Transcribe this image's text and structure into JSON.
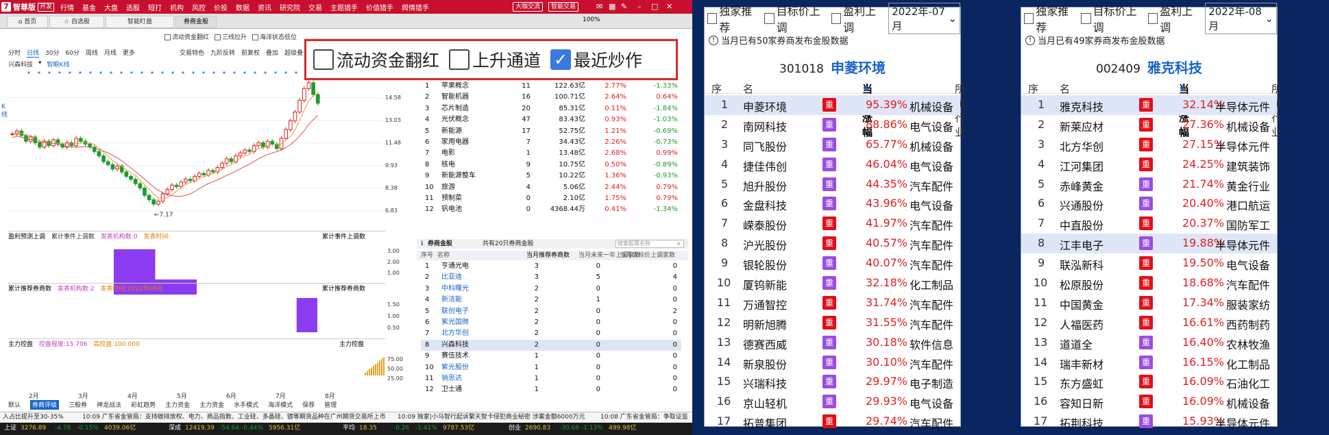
{
  "titlebar": {
    "logo_glyph": "7",
    "app_name": "智尊版",
    "version_badge": "开发",
    "menu": [
      "行情",
      "基金",
      "大盘",
      "选股",
      "短打",
      "机构",
      "风控",
      "价投",
      "数据",
      "资讯",
      "研究院",
      "交易",
      "主题猎手",
      "价值猎手",
      "舆情猎手"
    ],
    "pill_forum": "大咖交流",
    "pill_trade": "智能交易",
    "colors": {
      "bar": "#c8102e"
    }
  },
  "tabs": [
    "首页",
    "自选股",
    "智能盯盘",
    "券商金股"
  ],
  "checkbox_row": [
    "流动资金翻红",
    "三线拉升",
    "海洋状态低位"
  ],
  "zoom": "100%",
  "callout": {
    "items": [
      {
        "label": "流动资金翻红",
        "checked": false
      },
      {
        "label": "上升通道",
        "checked": false
      },
      {
        "label": "最近炒作",
        "checked": true
      }
    ]
  },
  "periods": [
    "分时",
    "日线",
    "30分",
    "60分",
    "周线",
    "月线",
    "更多"
  ],
  "period_active": "日线",
  "chart_tools": [
    "交易特色",
    "九阶反转",
    "前复权",
    "叠加",
    "超级叠"
  ],
  "stock_label": "兴森科技",
  "stock_sub": "智眼K线",
  "side_label": "K线",
  "chart_data": {
    "type": "line",
    "title": "",
    "x_ticks": [
      "2月",
      "3月",
      "4月",
      "5月",
      "6月",
      "7月",
      "8月"
    ],
    "y_ticks": [
      14.58,
      13.03,
      11.48,
      9.93,
      8.38,
      6.83
    ],
    "ylim": [
      6.83,
      16.2
    ],
    "low_label": "7.17",
    "close": [
      12.1,
      12.3,
      12.0,
      11.6,
      11.9,
      11.5,
      11.2,
      11.6,
      11.3,
      11.7,
      11.4,
      11.2,
      11.5,
      11.3,
      11.8,
      11.6,
      11.4,
      11.2,
      10.9,
      10.6,
      10.2,
      10.0,
      9.7,
      9.9,
      9.5,
      9.2,
      9.0,
      8.7,
      8.4,
      7.9,
      7.6,
      7.3,
      7.5,
      8.0,
      8.3,
      8.6,
      8.5,
      8.8,
      9.0,
      8.9,
      9.2,
      9.4,
      9.3,
      9.6,
      9.5,
      9.8,
      10.1,
      10.4,
      10.2,
      10.6,
      10.8,
      11.0,
      10.9,
      11.3,
      11.5,
      11.2,
      11.6,
      11.4,
      11.1,
      11.8,
      12.4,
      13.0,
      13.6,
      14.4,
      15.2,
      15.6,
      14.8,
      14.2
    ],
    "indicators": [
      {
        "name": "盈利预测上调",
        "tags": [
          "累计事件上调数"
        ],
        "count_label": "发表机构数:0",
        "time_label": "发表时间:",
        "right_label": "累计事件上调数",
        "y_ticks": [
          "3.00",
          "2.00",
          "1.00"
        ],
        "bars": [
          {
            "from": 0.28,
            "to": 0.39,
            "value": 3
          },
          {
            "from": 0.39,
            "to": 0.5,
            "value": 1
          }
        ]
      },
      {
        "name": "累计推荐券商数",
        "tags": [],
        "count_label": "发表机构数:2",
        "time_label": "发表时间:2022年08月",
        "right_label": "累计推荐券商数",
        "y_ticks": [
          "1.50",
          "1.00",
          "0.50"
        ],
        "bars": [
          {
            "from": 0.765,
            "to": 0.82,
            "value": 2
          }
        ]
      },
      {
        "name": "主力控盘",
        "tags": [],
        "count_label": "控盘程度:15.706",
        "time_label": "高控盘:100.000",
        "right_label": "主力控盘",
        "y_ticks": [
          "75.00",
          "50.00",
          "25.00"
        ],
        "bars": []
      }
    ]
  },
  "sector_table": {
    "rows": [
      [
        "1",
        "苹果概念",
        "11",
        "122.63亿",
        "2.77%",
        "-1.33%"
      ],
      [
        "2",
        "智能机器",
        "16",
        "100.71亿",
        "2.64%",
        "0.64%"
      ],
      [
        "3",
        "芯片制造",
        "20",
        "85.31亿",
        "0.11%",
        "-1.84%"
      ],
      [
        "4",
        "光伏概念",
        "47",
        "83.43亿",
        "0.93%",
        "-1.03%"
      ],
      [
        "5",
        "新能源",
        "17",
        "52.75亿",
        "1.21%",
        "-0.69%"
      ],
      [
        "6",
        "家用电器",
        "7",
        "34.43亿",
        "2.26%",
        "-0.73%"
      ],
      [
        "7",
        "电影",
        "1",
        "13.48亿",
        "2.68%",
        "0.99%"
      ],
      [
        "8",
        "核电",
        "9",
        "10.75亿",
        "0.50%",
        "-0.89%"
      ],
      [
        "9",
        "新能源整车",
        "5",
        "10.22亿",
        "1.36%",
        "-0.93%"
      ],
      [
        "10",
        "旅游",
        "4",
        "5.06亿",
        "2.44%",
        "0.79%"
      ],
      [
        "11",
        "预制菜",
        "0",
        "2.10亿",
        "1.75%",
        "0.79%"
      ],
      [
        "12",
        "钒电池",
        "0",
        "4368.44万",
        "0.41%",
        "-1.34%"
      ]
    ]
  },
  "broker_panel": {
    "title": "券商金股",
    "subtitle": "共有20只券商金股",
    "search_placeholder": "搜索股票名称",
    "headers": [
      "序号",
      "名称",
      "当月推荐券商数",
      "当月未来一年上调家数",
      "当月目标价上调家数"
    ],
    "rows": [
      [
        "1",
        "亨通光电",
        "3",
        "0",
        "0"
      ],
      [
        "2",
        "比亚迪",
        "3",
        "5",
        "4"
      ],
      [
        "3",
        "中科曙光",
        "2",
        "0",
        "0"
      ],
      [
        "4",
        "新洁能",
        "2",
        "1",
        "0"
      ],
      [
        "5",
        "联创电子",
        "2",
        "0",
        "2"
      ],
      [
        "6",
        "紫光国微",
        "2",
        "0",
        "0"
      ],
      [
        "7",
        "北方华创",
        "2",
        "0",
        "0"
      ],
      [
        "8",
        "兴森科技",
        "2",
        "0",
        "0"
      ],
      [
        "9",
        "赛伍技术",
        "1",
        "0",
        "0"
      ],
      [
        "10",
        "紫光股份",
        "1",
        "0",
        "0"
      ],
      [
        "11",
        "钠思达",
        "1",
        "0",
        "0"
      ],
      [
        "12",
        "卫士通",
        "1",
        "0",
        "0"
      ]
    ]
  },
  "bottom_tabs": [
    "默认",
    "券商评级",
    "三般券",
    "神龙战法",
    "彩虹趋势",
    "主力资金",
    "主力资金",
    "水手模式",
    "海洋模式",
    "保荐",
    "管理"
  ],
  "bottom_tab_active": "券商评级",
  "ticker": [
    "入占比提升至30-35%",
    "10:09 广东省金管局：支持碳排放权、电力、商品指数、工业硅、多晶硅、镀等期货品种在广州期货交易所上市",
    "10:09 独家|小马智行起诉繁天智卡侵犯商业秘密 涉案金额6000万元",
    "10:08 广东省金管局：争取证监"
  ],
  "indices": [
    {
      "name": "上证",
      "value": "3276.89",
      "chg": "-4.78",
      "pct": "-0.15%",
      "amt": "4039.06亿"
    },
    {
      "name": "深成",
      "value": "12419.39",
      "chg": "-54.64",
      "pct": "-0.44%",
      "amt": "5956.31亿"
    },
    {
      "name": "平均",
      "value": "18.35",
      "chg": "-0.26",
      "pct": "-1.41%",
      "amt": "9787.53亿"
    },
    {
      "name": "创业",
      "value": "2690.83",
      "chg": "-30.66",
      "pct": "-1.13%",
      "amt": "499.98亿"
    }
  ],
  "panel_july": {
    "filters": [
      "独家推荐",
      "目标价上调",
      "盈利上调"
    ],
    "month": "2022年-07月",
    "note": "当月已有50家券商发布金股数据",
    "code": "301018",
    "name": "申菱环境",
    "headers": [
      "序号",
      "名称",
      "当月涨幅",
      "所属行业"
    ],
    "rows": [
      [
        "1",
        "申菱环境",
        "重",
        "95.39%",
        "机械设备"
      ],
      [
        "2",
        "南网科技",
        "重",
        "88.86%",
        "电气设备"
      ],
      [
        "3",
        "同飞股份",
        "重",
        "65.77%",
        "机械设备"
      ],
      [
        "4",
        "捷佳伟创",
        "重",
        "46.04%",
        "电气设备"
      ],
      [
        "5",
        "旭升股份",
        "重",
        "44.35%",
        "汽车配件"
      ],
      [
        "6",
        "金盘科技",
        "重",
        "43.96%",
        "电气设备"
      ],
      [
        "7",
        "嵘泰股份",
        "重",
        "41.97%",
        "汽车配件"
      ],
      [
        "8",
        "沪光股份",
        "重",
        "40.57%",
        "汽车配件"
      ],
      [
        "9",
        "银轮股份",
        "重",
        "40.07%",
        "汽车配件"
      ],
      [
        "10",
        "厦钨新能",
        "重",
        "32.18%",
        "化工制品"
      ],
      [
        "11",
        "万通智控",
        "重",
        "31.74%",
        "汽车配件"
      ],
      [
        "12",
        "明新旭腾",
        "重",
        "31.55%",
        "汽车配件"
      ],
      [
        "13",
        "德赛西威",
        "重",
        "30.18%",
        "软件信息"
      ],
      [
        "14",
        "新泉股份",
        "重",
        "30.10%",
        "汽车配件"
      ],
      [
        "15",
        "兴瑞科技",
        "重",
        "29.97%",
        "电子制造"
      ],
      [
        "16",
        "京山轻机",
        "重",
        "29.93%",
        "电气设备"
      ],
      [
        "17",
        "拓普集团",
        "重",
        "29.74%",
        "汽车配件"
      ]
    ],
    "badge_colors": [
      "red",
      "purple",
      "purple",
      "purple",
      "purple",
      "purple",
      "red",
      "red",
      "purple",
      "purple",
      "red",
      "red",
      "purple",
      "purple",
      "purple",
      "purple",
      "red"
    ]
  },
  "panel_aug": {
    "filters": [
      "独家推荐",
      "目标价上调",
      "盈利上调"
    ],
    "month": "2022年-08月",
    "note": "当月已有49家券商发布金股数据",
    "code": "002409",
    "name": "雅克科技",
    "headers": [
      "序号",
      "名称",
      "当月涨幅",
      "所属行业"
    ],
    "rows": [
      [
        "1",
        "雅克科技",
        "重",
        "32.14%",
        "半导体元件"
      ],
      [
        "2",
        "新莱应材",
        "重",
        "27.36%",
        "机械设备"
      ],
      [
        "3",
        "北方华创",
        "重",
        "27.15%",
        "半导体元件"
      ],
      [
        "4",
        "江河集团",
        "重",
        "24.25%",
        "建筑装饰"
      ],
      [
        "5",
        "赤峰黄金",
        "重",
        "21.74%",
        "黄金行业"
      ],
      [
        "6",
        "兴通股份",
        "重",
        "20.40%",
        "港口航运"
      ],
      [
        "7",
        "中直股份",
        "重",
        "20.37%",
        "国防军工"
      ],
      [
        "8",
        "江丰电子",
        "重",
        "19.88%",
        "半导体元件"
      ],
      [
        "9",
        "联泓新科",
        "重",
        "19.50%",
        "电气设备"
      ],
      [
        "10",
        "松原股份",
        "重",
        "18.68%",
        "汽车配件"
      ],
      [
        "11",
        "中国黄金",
        "重",
        "17.34%",
        "服装家纺"
      ],
      [
        "12",
        "人福医药",
        "重",
        "16.61%",
        "西药制药"
      ],
      [
        "13",
        "道道全",
        "重",
        "16.40%",
        "农林牧渔"
      ],
      [
        "14",
        "瑞丰新材",
        "重",
        "16.15%",
        "化工制品"
      ],
      [
        "15",
        "东方盛虹",
        "重",
        "16.09%",
        "石油化工"
      ],
      [
        "16",
        "容知日新",
        "重",
        "16.09%",
        "机械设备"
      ],
      [
        "17",
        "拓荆科技",
        "重",
        "15.93%",
        "半导体元件"
      ]
    ],
    "badge_colors": [
      "red",
      "red",
      "red",
      "red",
      "purple",
      "purple",
      "red",
      "purple",
      "red",
      "red",
      "red",
      "red",
      "purple",
      "purple",
      "red",
      "red",
      "purple"
    ]
  },
  "colors": {
    "up": "#e02020",
    "down": "#1a9e2a",
    "accent": "#1a64c8",
    "badge_red": "#e0101a",
    "badge_purple": "#9b4de0",
    "ind_bar": "#8c3cf0"
  }
}
